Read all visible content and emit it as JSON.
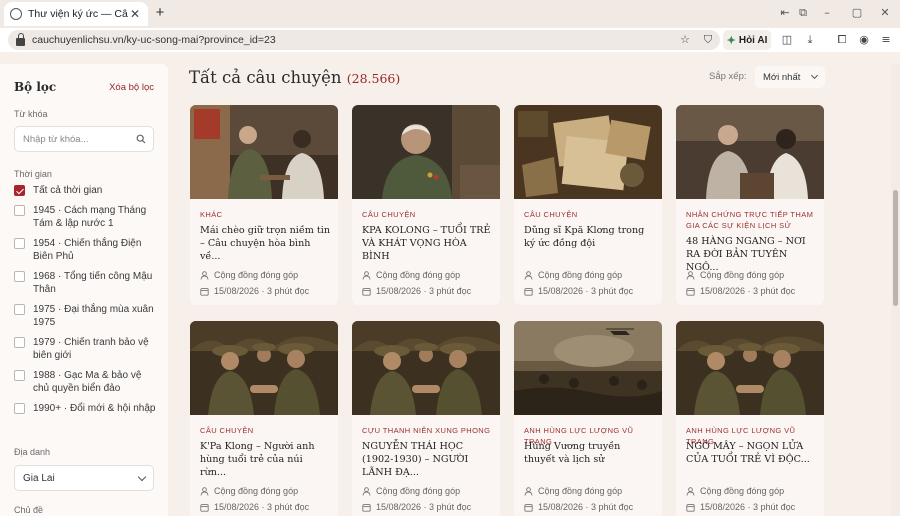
{
  "browser": {
    "tab_title": "Thư viện ký ức — Câu chuyện",
    "url": "cauchuyenlichsu.vn/ky-uc-song-mai?province_id=23",
    "ai_button": "Hỏi AI"
  },
  "sidebar": {
    "title": "Bộ lọc",
    "clear": "Xóa bộ lọc",
    "keyword_label": "Từ khóa",
    "keyword_placeholder": "Nhập từ khóa...",
    "time_label": "Thời gian",
    "time_options": [
      {
        "label": "Tất cả thời gian",
        "checked": true
      },
      {
        "label": "1945 · Cách mạng Tháng Tám & lập nước 1",
        "checked": false
      },
      {
        "label": "1954 · Chiến thắng Điện Biên Phủ",
        "checked": false
      },
      {
        "label": "1968 · Tổng tiến công Mậu Thân",
        "checked": false
      },
      {
        "label": "1975 · Đại thắng mùa xuân 1975",
        "checked": false
      },
      {
        "label": "1979 · Chiến tranh bảo vệ biên giới",
        "checked": false
      },
      {
        "label": "1988 · Gạc Ma & bảo vệ chủ quyền biển đảo",
        "checked": false
      },
      {
        "label": "1990+ · Đổi mới & hội nhập",
        "checked": false
      }
    ],
    "place_label": "Địa danh",
    "place_value": "Gia Lai",
    "topic_label": "Chủ đề"
  },
  "main": {
    "title": "Tất cả câu chuyện",
    "count": "(28.566)",
    "sort_label": "Sắp xếp:",
    "sort_value": "Mới nhất"
  },
  "cards": [
    {
      "category": "KHÁC",
      "title": "Mái chèo giữ trọn niềm tin – Câu chuyện hòa bình về...",
      "author": "Cộng đồng đóng góp",
      "date": "15/08/2026 · 3 phút đọc",
      "image": "interview-veterans"
    },
    {
      "category": "CÂU CHUYỆN",
      "title": "KPA KOLONG – TUỔI TRẺ VÀ KHÁT VỌNG HÒA BÌNH",
      "author": "Cộng đồng đóng góp",
      "date": "15/08/2026 · 3 phút đọc",
      "image": "veteran-portrait"
    },
    {
      "category": "CÂU CHUYỆN",
      "title": "Dũng sĩ Kpă Klơng trong ký ức đồng đội",
      "author": "Cộng đồng đóng góp",
      "date": "15/08/2026 · 3 phút đọc",
      "image": "old-letters"
    },
    {
      "category": "NHÂN CHỨNG TRỰC TIẾP THAM GIA CÁC SỰ KIỆN LỊCH SỬ",
      "title": "48 HÀNG NGANG – NƠI RA ĐỜI BẢN TUYÊN NGÔ...",
      "author": "Cộng đồng đóng góp",
      "date": "15/08/2026 · 3 phút đọc",
      "image": "elder-woman-interview"
    },
    {
      "category": "CÂU CHUYỆN",
      "title": "K'Pa Klong – Người anh hùng tuổi trẻ của núi rừn...",
      "author": "Cộng đồng đóng góp",
      "date": "15/08/2026 · 3 phút đọc",
      "image": "soldiers-handshake"
    },
    {
      "category": "CỰU THANH NIÊN XUNG PHONG",
      "title": "NGUYỄN THÁI HỌC (1902-1930) – NGƯỜI LÃNH ĐẠ...",
      "author": "Cộng đồng đóng góp",
      "date": "15/08/2026 · 3 phút đọc",
      "image": "soldiers-handshake"
    },
    {
      "category": "ANH HÙNG LỰC LƯỢNG VŨ TRANG",
      "title": "Hùng Vương truyền thuyết và lịch sử",
      "author": "Cộng đồng đóng góp",
      "date": "15/08/2026 · 3 phút đọc",
      "image": "battlefield"
    },
    {
      "category": "ANH HÙNG LỰC LƯỢNG VŨ TRANG",
      "title": "NGÔ MÂY – NGỌN LỬA CỦA TUỔI TRẺ VÌ ĐỘC...",
      "author": "Cộng đồng đóng góp",
      "date": "15/08/2026 · 3 phút đọc",
      "image": "soldiers-handshake"
    }
  ],
  "colors": {
    "accent": "#a5262b",
    "background": "#f6efea",
    "card": "#fbf6f3"
  }
}
